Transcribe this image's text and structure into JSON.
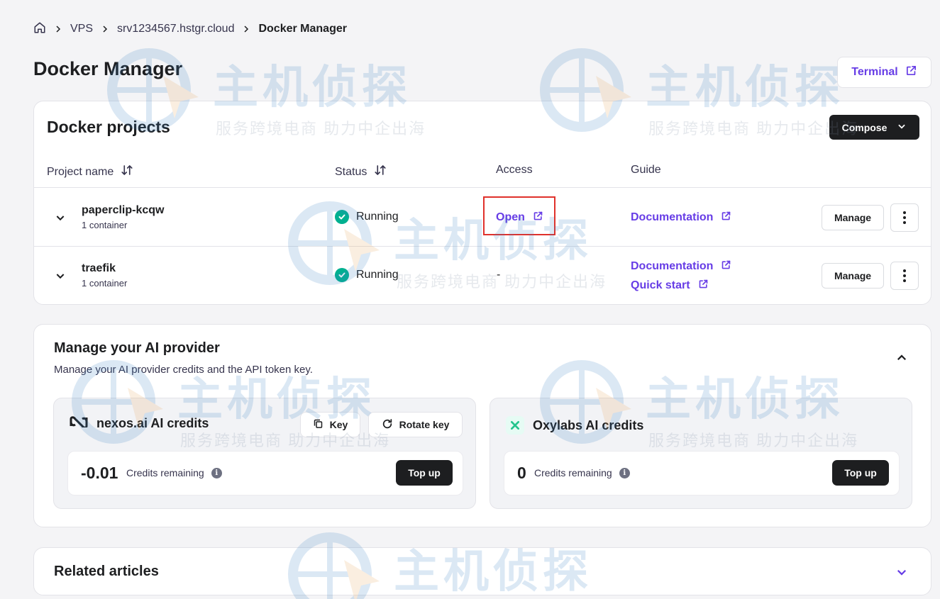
{
  "breadcrumb": {
    "items": [
      "VPS",
      "srv1234567.hstgr.cloud"
    ],
    "current": "Docker Manager"
  },
  "page_title": "Docker Manager",
  "terminal_label": "Terminal",
  "projects": {
    "title": "Docker projects",
    "compose_label": "Compose",
    "columns": {
      "name": "Project name",
      "status": "Status",
      "access": "Access",
      "guide": "Guide"
    },
    "rows": [
      {
        "name": "paperclip-kcqw",
        "sub": "1 container",
        "status": "Running",
        "access": "Open",
        "guides": [
          "Documentation"
        ],
        "manage": "Manage"
      },
      {
        "name": "traefik",
        "sub": "1 container",
        "status": "Running",
        "access": "-",
        "guides": [
          "Documentation",
          "Quick start"
        ],
        "manage": "Manage"
      }
    ]
  },
  "ai_provider": {
    "title": "Manage your AI provider",
    "subtitle": "Manage your AI provider credits and the API token key.",
    "panels": [
      {
        "name": "nexos.ai AI credits",
        "amount": "-0.01",
        "credits_label": "Credits remaining",
        "key_label": "Key",
        "rotate_label": "Rotate key",
        "topup_label": "Top up"
      },
      {
        "name": "Oxylabs AI credits",
        "amount": "0",
        "credits_label": "Credits remaining",
        "topup_label": "Top up"
      }
    ]
  },
  "related_articles": "Related articles",
  "watermark": {
    "main": "主机侦探",
    "sub": "服务跨境电商 助力中企出海"
  },
  "colors": {
    "accent": "#673de6",
    "success": "#00b090",
    "dark": "#1d1e20",
    "highlight": "#e0312b"
  }
}
